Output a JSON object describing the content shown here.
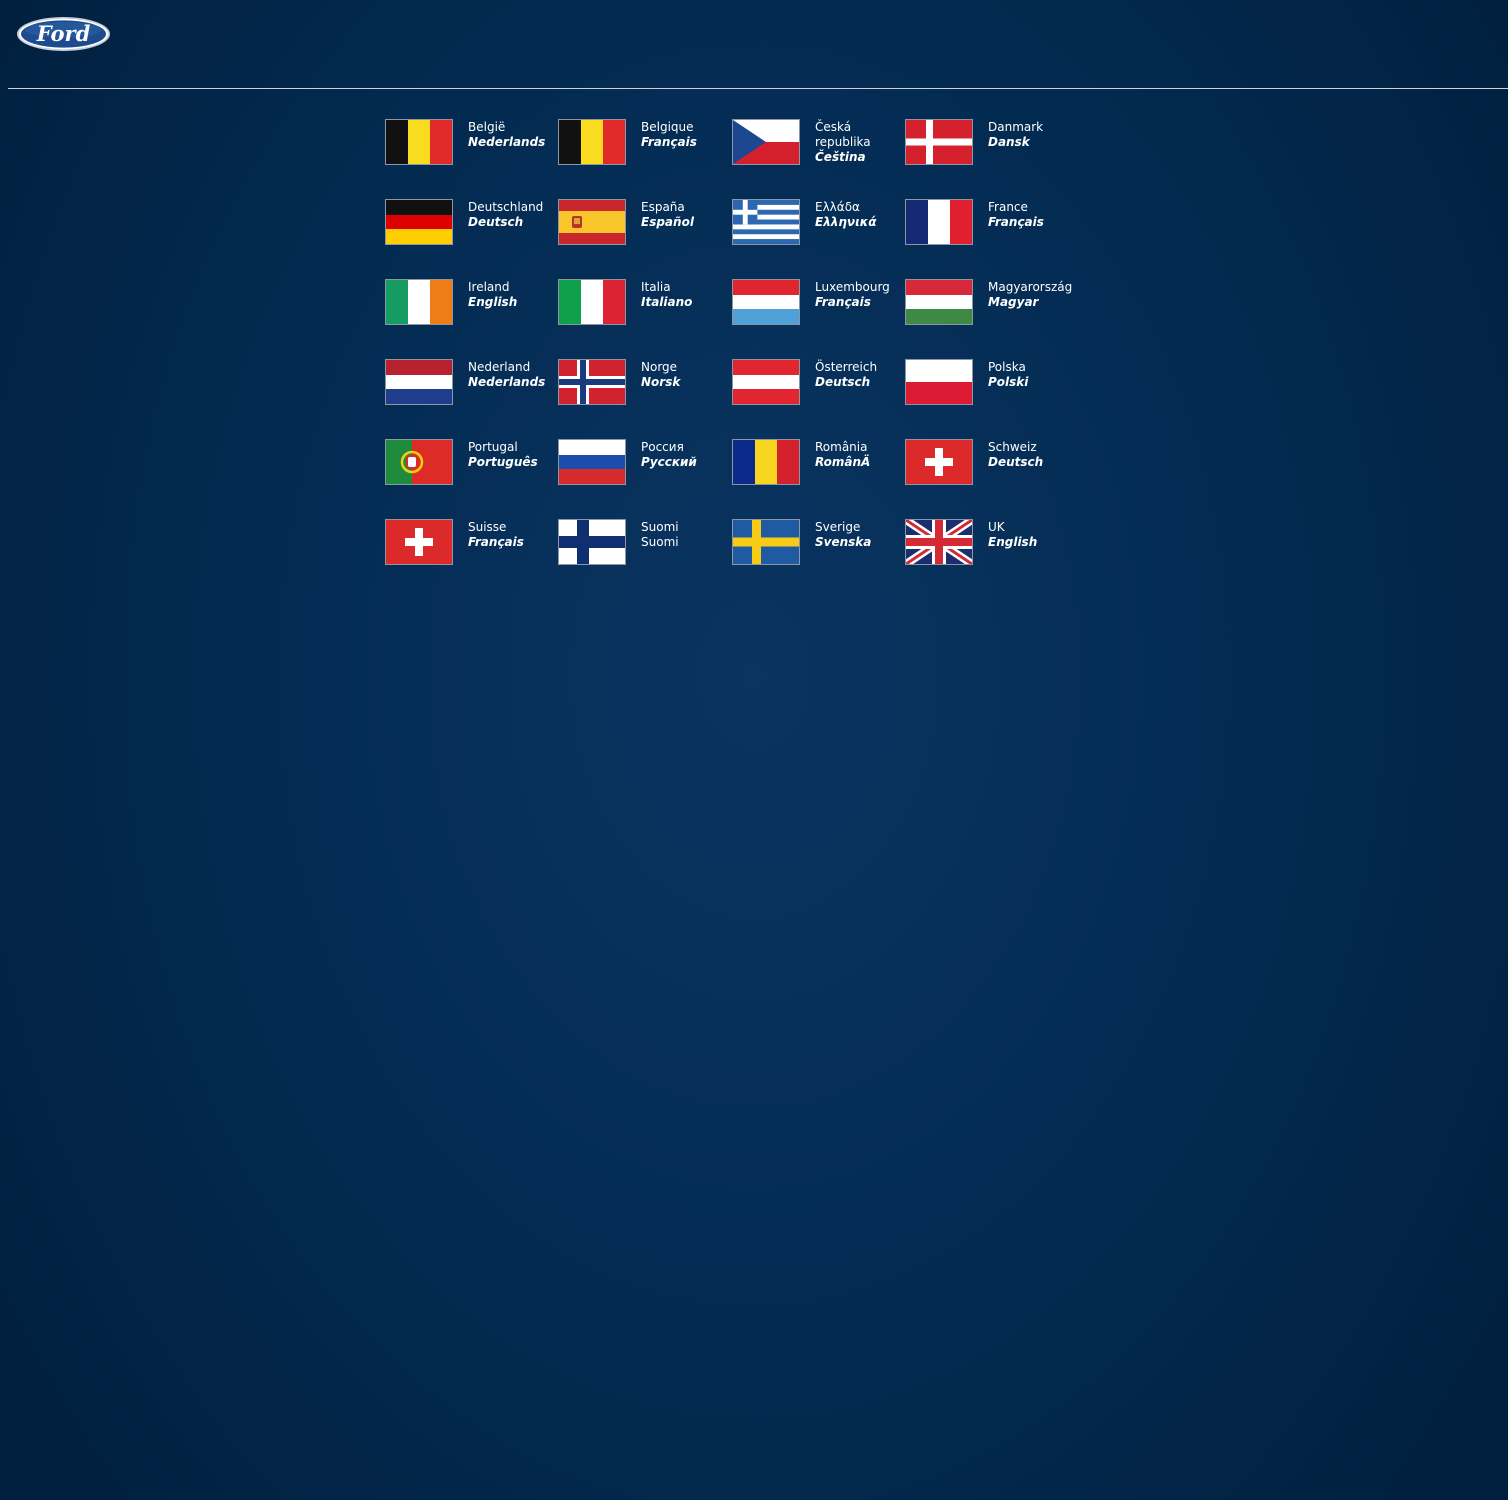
{
  "brand": {
    "logo_text": "Ford",
    "colors": {
      "logo_blue": "#1c4c8f",
      "background": "#032b52"
    }
  },
  "countries": [
    {
      "country": "België",
      "language": "Nederlands",
      "flag": "belgium"
    },
    {
      "country": "Belgique",
      "language": "Français",
      "flag": "belgium"
    },
    {
      "country": "Česká republika",
      "language": "Čeština",
      "flag": "czech"
    },
    {
      "country": "Danmark",
      "language": "Dansk",
      "flag": "denmark"
    },
    {
      "country": "Deutschland",
      "language": "Deutsch",
      "flag": "germany"
    },
    {
      "country": "España",
      "language": "Español",
      "flag": "spain"
    },
    {
      "country": "Ελλάδα",
      "language": "Ελληνικά",
      "flag": "greece"
    },
    {
      "country": "France",
      "language": "Français",
      "flag": "france"
    },
    {
      "country": "Ireland",
      "language": "English",
      "flag": "ireland"
    },
    {
      "country": "Italia",
      "language": "Italiano",
      "flag": "italy"
    },
    {
      "country": "Luxembourg",
      "language": "Français",
      "flag": "luxembourg"
    },
    {
      "country": "Magyarország",
      "language": "Magyar",
      "flag": "hungary"
    },
    {
      "country": "Nederland",
      "language": "Nederlands",
      "flag": "netherlands"
    },
    {
      "country": "Norge",
      "language": "Norsk",
      "flag": "norway"
    },
    {
      "country": "Österreich",
      "language": "Deutsch",
      "flag": "austria"
    },
    {
      "country": "Polska",
      "language": "Polski",
      "flag": "poland"
    },
    {
      "country": "Portugal",
      "language": "Português",
      "flag": "portugal"
    },
    {
      "country": "Россия",
      "language": "Русский",
      "flag": "russia"
    },
    {
      "country": "România",
      "language": "RomânÄ",
      "flag": "romania"
    },
    {
      "country": "Schweiz",
      "language": "Deutsch",
      "flag": "switzerland"
    },
    {
      "country": "Suisse",
      "language": "Français",
      "flag": "switzerland"
    },
    {
      "country": "Suomi",
      "language": "Suomi",
      "flag": "finland",
      "language_plain": true
    },
    {
      "country": "Sverige",
      "language": "Svenska",
      "flag": "sweden"
    },
    {
      "country": "UK",
      "language": "English",
      "flag": "uk"
    }
  ]
}
